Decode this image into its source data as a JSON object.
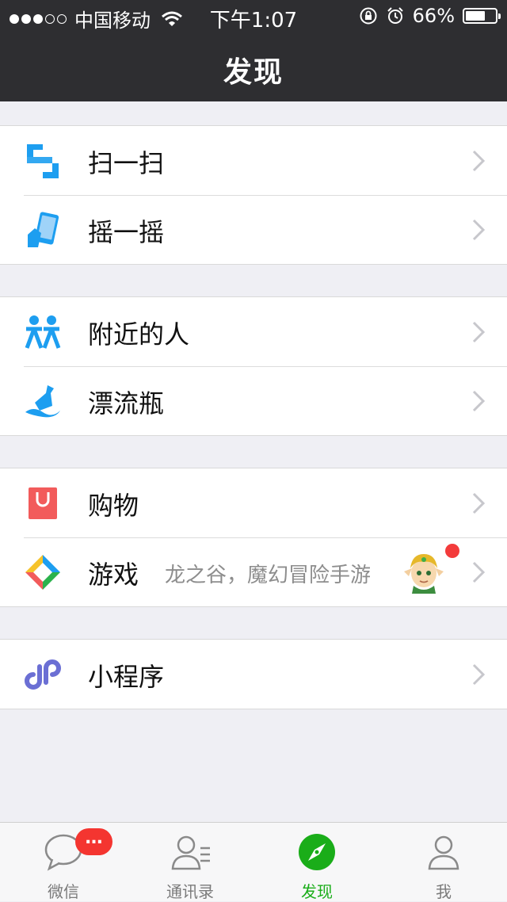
{
  "status_bar": {
    "carrier": "中国移动",
    "time": "下午1:07",
    "battery_percent": "66%",
    "battery_level": 0.66,
    "signal_bars_filled": 3,
    "signal_bars_total": 5
  },
  "header": {
    "title": "发现"
  },
  "groups": [
    {
      "items": [
        {
          "icon": "scan-icon",
          "label": "扫一扫"
        },
        {
          "icon": "shake-icon",
          "label": "摇一摇"
        }
      ]
    },
    {
      "items": [
        {
          "icon": "people-nearby-icon",
          "label": "附近的人"
        },
        {
          "icon": "drift-bottle-icon",
          "label": "漂流瓶"
        }
      ]
    },
    {
      "items": [
        {
          "icon": "shopping-bag-icon",
          "label": "购物"
        },
        {
          "icon": "games-icon",
          "label": "游戏",
          "subtitle": "龙之谷，魔幻冒险手游",
          "avatar": "game-character-avatar",
          "has_red_dot": true
        }
      ]
    },
    {
      "items": [
        {
          "icon": "mini-program-icon",
          "label": "小程序"
        }
      ]
    }
  ],
  "tabbar": {
    "tabs": [
      {
        "icon": "chat-bubble-icon",
        "label": "微信",
        "badge": "…"
      },
      {
        "icon": "contacts-icon",
        "label": "通讯录"
      },
      {
        "icon": "compass-icon",
        "label": "发现",
        "active": true
      },
      {
        "icon": "person-icon",
        "label": "我"
      }
    ]
  },
  "colors": {
    "header_bg": "#2e2e31",
    "page_bg": "#efeff4",
    "accent_green": "#1aad19",
    "badge_red": "#f43530",
    "icon_blue": "#1d9ef0"
  }
}
